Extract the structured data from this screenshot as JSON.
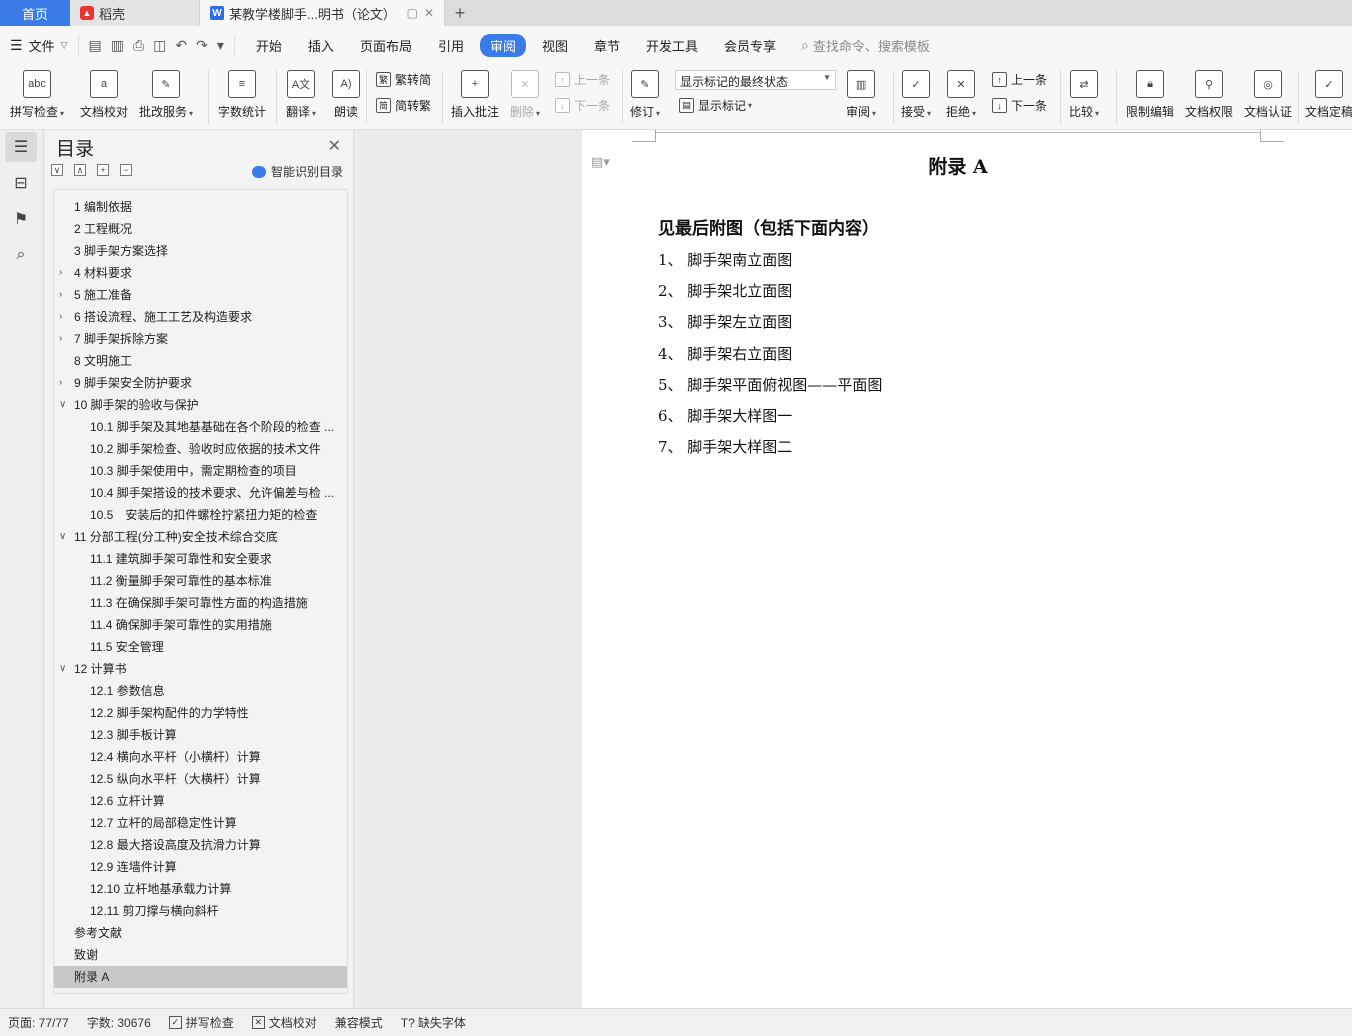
{
  "tabs": {
    "home": "首页",
    "daoke": "稻壳",
    "doc": "某教学楼脚手...明书（论文）"
  },
  "menu": {
    "file": "文件",
    "ribbon_tabs": [
      "开始",
      "插入",
      "页面布局",
      "引用",
      "审阅",
      "视图",
      "章节",
      "开发工具",
      "会员专享"
    ],
    "active_tab": "审阅",
    "search_placeholder": "查找命令、搜索模板"
  },
  "ribbon": {
    "spell_check": "拼写检查",
    "doc_proof": "文档校对",
    "review_service": "批改服务",
    "word_count": "字数统计",
    "translate": "翻译",
    "read_aloud": "朗读",
    "trad": "繁转简",
    "simp": "简转繁",
    "insert_comment": "插入批注",
    "delete": "删除",
    "prev_comment": "上一条",
    "next_comment": "下一条",
    "track": "修订",
    "markup_state": "显示标记的最终状态",
    "show_markup": "显示标记",
    "review": "审阅",
    "accept": "接受",
    "reject": "拒绝",
    "prev_change": "上一条",
    "next_change": "下一条",
    "compare": "比较",
    "restrict": "限制编辑",
    "doc_rights": "文档权限",
    "doc_cert": "文档认证",
    "doc_final": "文档定稿"
  },
  "toc": {
    "title": "目录",
    "smart_label": "智能识别目录",
    "items": [
      {
        "label": "1 编制依据",
        "level": 1,
        "chevron": ""
      },
      {
        "label": "2 工程概况",
        "level": 1,
        "chevron": ""
      },
      {
        "label": "3 脚手架方案选择",
        "level": 1,
        "chevron": ""
      },
      {
        "label": "4 材料要求",
        "level": 1,
        "chevron": ">"
      },
      {
        "label": "5 施工准备",
        "level": 1,
        "chevron": ">"
      },
      {
        "label": "6 搭设流程、施工工艺及构造要求",
        "level": 1,
        "chevron": ">"
      },
      {
        "label": "7 脚手架拆除方案",
        "level": 1,
        "chevron": ">"
      },
      {
        "label": "8 文明施工",
        "level": 1,
        "chevron": ""
      },
      {
        "label": "9 脚手架安全防护要求",
        "level": 1,
        "chevron": ">"
      },
      {
        "label": "10 脚手架的验收与保护",
        "level": 1,
        "chevron": "v"
      },
      {
        "label": "10.1 脚手架及其地基基础在各个阶段的检查 ...",
        "level": 2,
        "chevron": ""
      },
      {
        "label": "10.2 脚手架检查、验收时应依据的技术文件",
        "level": 2,
        "chevron": ""
      },
      {
        "label": "10.3 脚手架使用中，需定期检查的项目",
        "level": 2,
        "chevron": ""
      },
      {
        "label": "10.4 脚手架搭设的技术要求、允许偏差与检 ...",
        "level": 2,
        "chevron": ""
      },
      {
        "label": "10.5　安装后的扣件螺栓拧紧扭力矩的检查",
        "level": 2,
        "chevron": ""
      },
      {
        "label": "11 分部工程(分工种)安全技术综合交底",
        "level": 1,
        "chevron": "v"
      },
      {
        "label": "11.1 建筑脚手架可靠性和安全要求",
        "level": 2,
        "chevron": ""
      },
      {
        "label": "11.2 衡量脚手架可靠性的基本标准",
        "level": 2,
        "chevron": ""
      },
      {
        "label": "11.3 在确保脚手架可靠性方面的构造措施",
        "level": 2,
        "chevron": ""
      },
      {
        "label": "11.4 确保脚手架可靠性的实用措施",
        "level": 2,
        "chevron": ""
      },
      {
        "label": "11.5 安全管理",
        "level": 2,
        "chevron": ""
      },
      {
        "label": "12 计算书",
        "level": 1,
        "chevron": "v"
      },
      {
        "label": "12.1 参数信息",
        "level": 2,
        "chevron": ""
      },
      {
        "label": "12.2 脚手架构配件的力学特性",
        "level": 2,
        "chevron": ""
      },
      {
        "label": "12.3 脚手板计算",
        "level": 2,
        "chevron": ""
      },
      {
        "label": "12.4 横向水平杆（小横杆）计算",
        "level": 2,
        "chevron": ""
      },
      {
        "label": "12.5 纵向水平杆（大横杆）计算",
        "level": 2,
        "chevron": ""
      },
      {
        "label": "12.6 立杆计算",
        "level": 2,
        "chevron": ""
      },
      {
        "label": "12.7 立杆的局部稳定性计算",
        "level": 2,
        "chevron": ""
      },
      {
        "label": "12.8 最大搭设高度及抗滑力计算",
        "level": 2,
        "chevron": ""
      },
      {
        "label": "12.9 连墙件计算",
        "level": 2,
        "chevron": ""
      },
      {
        "label": "12.10 立杆地基承载力计算",
        "level": 2,
        "chevron": ""
      },
      {
        "label": "12.11 剪刀撑与横向斜杆",
        "level": 2,
        "chevron": ""
      },
      {
        "label": "参考文献",
        "level": 1,
        "chevron": ""
      },
      {
        "label": "致谢",
        "level": 1,
        "chevron": ""
      },
      {
        "label": "附录 A",
        "level": 1,
        "chevron": "",
        "selected": true
      }
    ]
  },
  "document": {
    "heading": "附录 A",
    "subtitle": "见最后附图（包括下面内容）",
    "items": [
      "1、 脚手架南立面图",
      "2、 脚手架北立面图",
      "3、 脚手架左立面图",
      "4、 脚手架右立面图",
      "5、 脚手架平面俯视图——平面图",
      "6、 脚手架大样图一",
      "7、 脚手架大样图二"
    ]
  },
  "status": {
    "page": "页面: 77/77",
    "words": "字数: 30676",
    "spell": "拼写检查",
    "proof": "文档校对",
    "compat": "兼容模式",
    "missing_font": "缺失字体"
  },
  "colors": {
    "accent": "#3b7be8",
    "selected_row": "#c8c8c8"
  }
}
